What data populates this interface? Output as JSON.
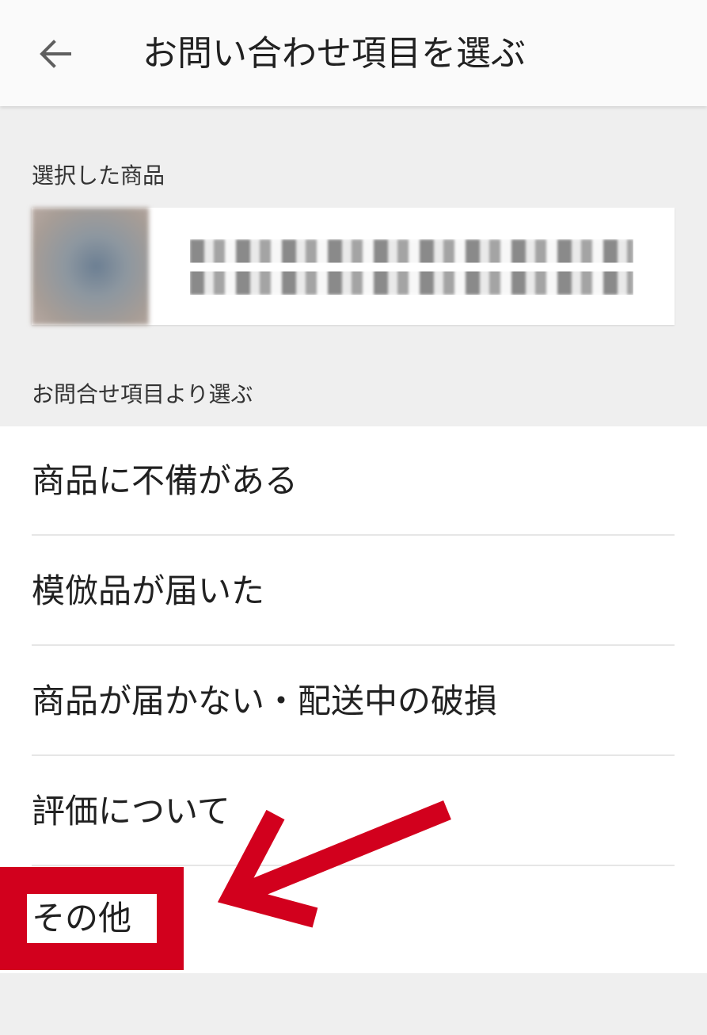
{
  "header": {
    "title": "お問い合わせ項目を選ぶ",
    "back_icon": "arrow-left-icon"
  },
  "product_section": {
    "label": "選択した商品"
  },
  "inquiry_section": {
    "label": "お問合せ項目より選ぶ",
    "items": [
      {
        "label": "商品に不備がある"
      },
      {
        "label": "模倣品が届いた"
      },
      {
        "label": "商品が届かない・配送中の破損"
      },
      {
        "label": "評価について"
      },
      {
        "label": "その他"
      }
    ]
  },
  "annotation": {
    "highlight_color": "#d2001d",
    "arrow_color": "#d2001d"
  }
}
